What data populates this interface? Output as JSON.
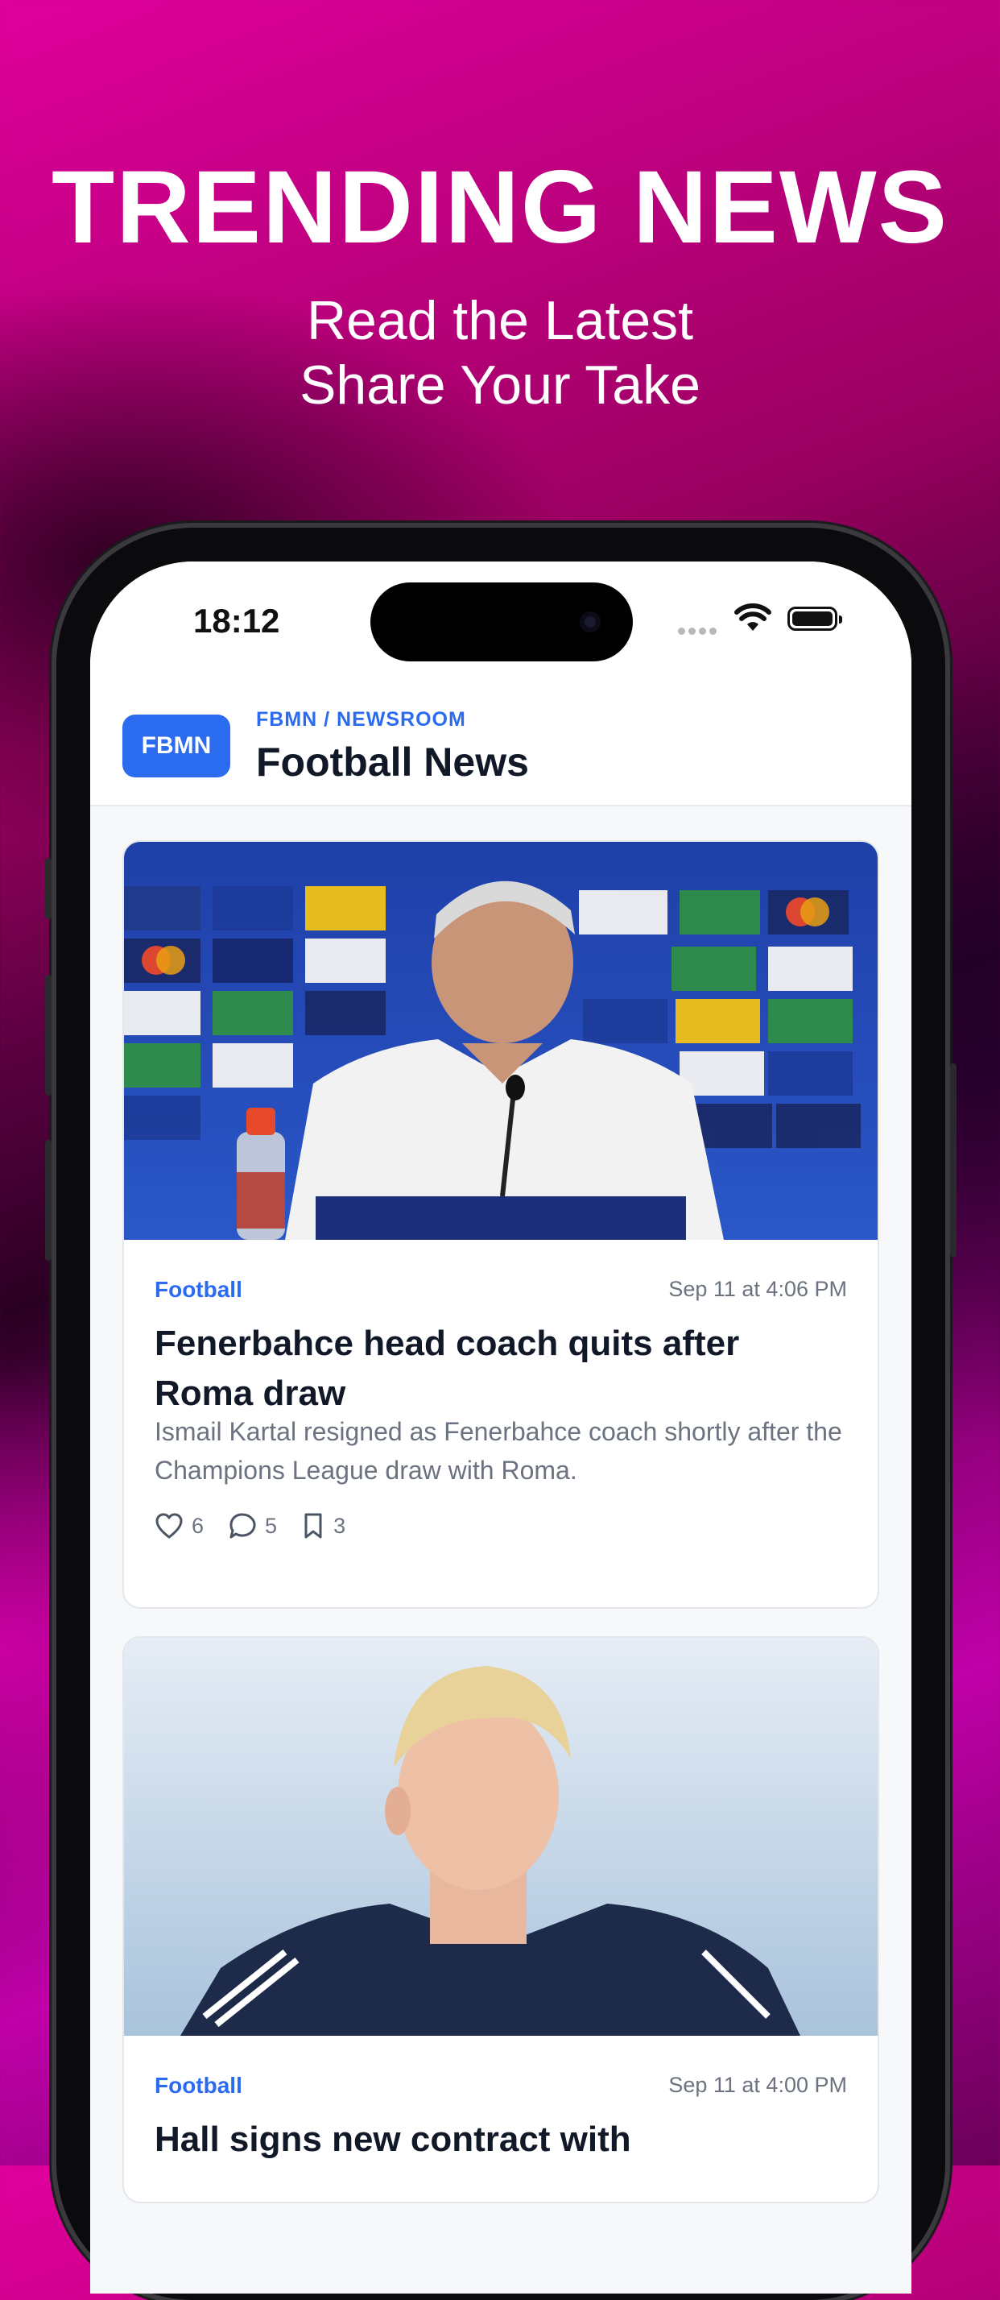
{
  "hero": {
    "title": "TRENDING NEWS",
    "subtitle_line1": "Read the Latest",
    "subtitle_line2": "Share Your Take"
  },
  "status_bar": {
    "time": "18:12"
  },
  "app_header": {
    "logo": "FBMN",
    "breadcrumb": "FBMN / NEWSROOM",
    "title": "Football News"
  },
  "articles": [
    {
      "category": "Football",
      "timestamp": "Sep 11 at 4:06 PM",
      "headline": "Fenerbahce head coach quits after Roma draw",
      "excerpt": "Ismail Kartal resigned as Fenerbahce coach shortly after the Champions League draw with Roma.",
      "likes": "6",
      "comments": "5",
      "bookmarks": "3"
    },
    {
      "category": "Football",
      "timestamp": "Sep 11 at 4:00 PM",
      "headline": "Hall signs new contract with"
    }
  ],
  "colors": {
    "accent": "#2b6bf0",
    "headline": "#111827",
    "muted": "#6b7280"
  }
}
